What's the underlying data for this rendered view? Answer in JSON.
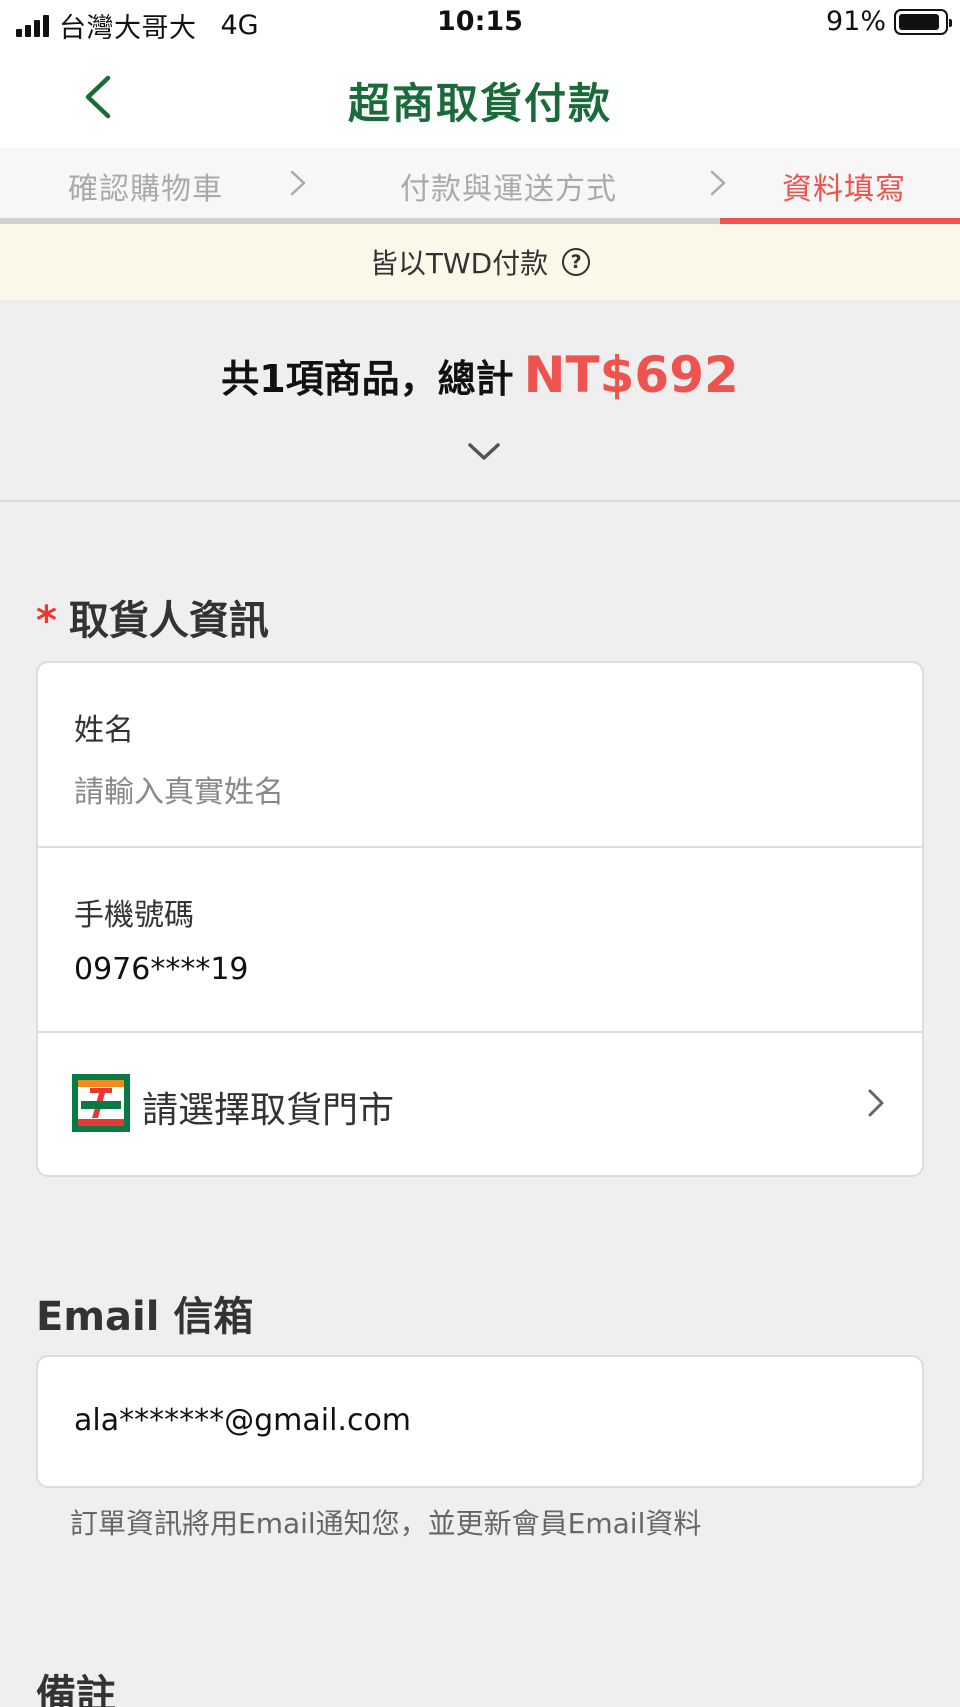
{
  "status_bar": {
    "carrier": "台灣大哥大",
    "network": "4G",
    "time": "10:15",
    "battery": "91%",
    "battery_level": 0.91
  },
  "header": {
    "title": "超商取貨付款"
  },
  "steps": {
    "items": [
      {
        "label": "確認購物車",
        "active": false
      },
      {
        "label": "付款與運送方式",
        "active": false
      },
      {
        "label": "資料填寫",
        "active": true
      }
    ]
  },
  "currency_notice": {
    "text": "皆以TWD付款"
  },
  "summary": {
    "text": "共1項商品，總計",
    "total": "NT$692"
  },
  "recipient": {
    "title": "取貨人資訊",
    "required_mark": "*",
    "name_label": "姓名",
    "name_placeholder": "請輸入真實姓名",
    "phone_label": "手機號碼",
    "phone_value": "0976****19",
    "store_label": "請選擇取貨門市"
  },
  "email": {
    "title": "Email 信箱",
    "value": "ala*******@gmail.com",
    "hint": "訂單資訊將用Email通知您，並更新會員Email資料"
  },
  "notes": {
    "title": "備註"
  },
  "colors": {
    "brand_green": "#1b6b3a",
    "accent_red": "#ef5350",
    "required_red": "#e53935",
    "notice_bg": "#fbf8e9"
  }
}
